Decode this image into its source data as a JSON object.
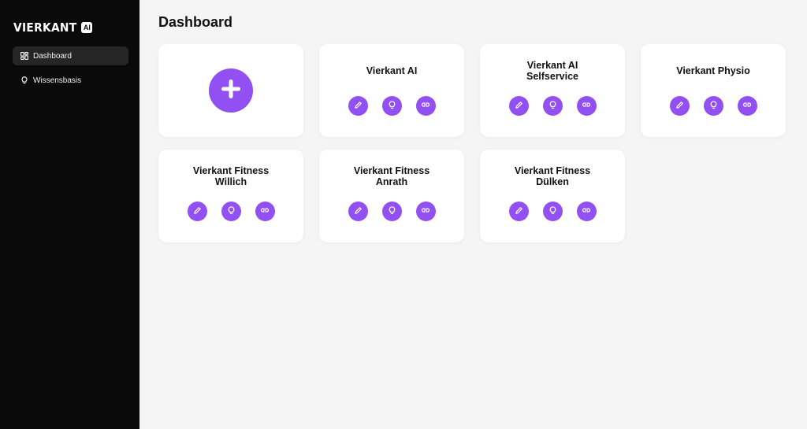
{
  "app": {
    "logo_text": "VIERKANT",
    "logo_badge": "AI"
  },
  "sidebar": {
    "items": [
      {
        "label": "Dashboard",
        "icon": "dashboard-icon",
        "active": true
      },
      {
        "label": "Wissensbasis",
        "icon": "lightbulb-icon",
        "active": false
      }
    ]
  },
  "main": {
    "title": "Dashboard",
    "add_card": {
      "icon": "plus-icon"
    },
    "cards": [
      {
        "title_lines": [
          "Vierkant AI"
        ]
      },
      {
        "title_lines": [
          "Vierkant AI",
          "Selfservice"
        ]
      },
      {
        "title_lines": [
          "Vierkant Physio"
        ]
      },
      {
        "title_lines": [
          "Vierkant Fitness",
          "Willich"
        ]
      },
      {
        "title_lines": [
          "Vierkant Fitness",
          "Anrath"
        ]
      },
      {
        "title_lines": [
          "Vierkant Fitness",
          "Dülken"
        ]
      }
    ],
    "card_actions": [
      "edit-icon",
      "lightbulb-icon",
      "link-icon"
    ]
  },
  "colors": {
    "accent": "#9250f2",
    "sidebar_bg": "#0a0a0a",
    "page_bg": "#f5f5f5"
  }
}
